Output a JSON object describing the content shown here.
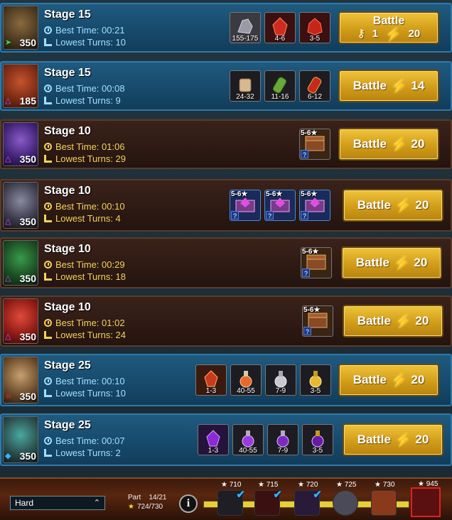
{
  "battle_label": "Battle",
  "colors": {
    "blue_row": "#174a6c",
    "brown_row": "#2f1a14",
    "battle_gold": "#d19d1a",
    "energy": "#ffe23a"
  },
  "rows": [
    {
      "stage": "Stage 15",
      "level": "350",
      "best_time": "Best Time: 00:21",
      "lowest_turns": "Lowest Turns: 10",
      "rewards": [
        "155-175",
        "4-6",
        "3-5"
      ],
      "keys": "1",
      "energy": "20"
    },
    {
      "stage": "Stage 15",
      "level": "185",
      "best_time": "Best Time: 00:08",
      "lowest_turns": "Lowest Turns: 9",
      "rewards": [
        "24-32",
        "11-16",
        "6-12"
      ],
      "energy": "14"
    },
    {
      "stage": "Stage 10",
      "level": "350",
      "best_time": "Best Time: 01:06",
      "lowest_turns": "Lowest Turns: 29",
      "chest_rank": "5-6★",
      "energy": "20"
    },
    {
      "stage": "Stage 10",
      "level": "350",
      "best_time": "Best Time: 00:10",
      "lowest_turns": "Lowest Turns: 4",
      "chest_rank": "5-6★",
      "energy": "20"
    },
    {
      "stage": "Stage 10",
      "level": "350",
      "best_time": "Best Time: 00:29",
      "lowest_turns": "Lowest Turns: 18",
      "chest_rank": "5-6★",
      "energy": "20"
    },
    {
      "stage": "Stage 10",
      "level": "350",
      "best_time": "Best Time: 01:02",
      "lowest_turns": "Lowest Turns: 24",
      "chest_rank": "5-6★",
      "energy": "20"
    },
    {
      "stage": "Stage 25",
      "level": "350",
      "best_time": "Best Time: 00:10",
      "lowest_turns": "Lowest Turns: 10",
      "rewards": [
        "1-3",
        "40-55",
        "7-9",
        "3-5"
      ],
      "energy": "20"
    },
    {
      "stage": "Stage 25",
      "level": "350",
      "best_time": "Best Time: 00:07",
      "lowest_turns": "Lowest Turns: 2",
      "rewards": [
        "1-3",
        "40-55",
        "7-9",
        "3-5"
      ],
      "energy": "20"
    }
  ],
  "bottom": {
    "difficulty": "Hard",
    "part_label": "Part",
    "part_value": "14/21",
    "stars_value": "724/730",
    "milestones": [
      "710",
      "715",
      "720",
      "725",
      "730",
      "945"
    ]
  }
}
